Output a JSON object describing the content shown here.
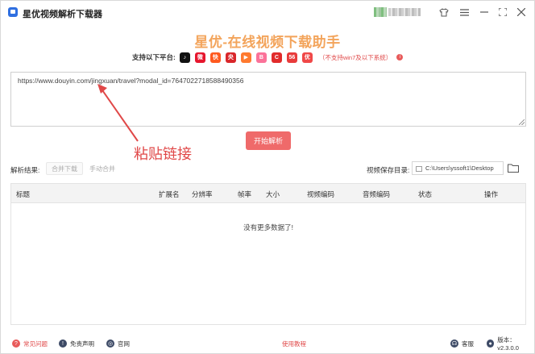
{
  "app": {
    "title": "星优视频解析下载器"
  },
  "headline": "星优-在线视频下载助手",
  "platforms": {
    "label": "支持以下平台:",
    "items": [
      {
        "name": "douyin-icon",
        "color": "#111111",
        "glyph": "♪"
      },
      {
        "name": "weibo-icon",
        "color": "#e6162d",
        "glyph": "微"
      },
      {
        "name": "kuaishou-icon",
        "color": "#ff5a1f",
        "glyph": "快"
      },
      {
        "name": "cctv-icon",
        "color": "#d9262a",
        "glyph": "央"
      },
      {
        "name": "tencent-video-icon",
        "color": "#ff7a2f",
        "glyph": "▶"
      },
      {
        "name": "bilibili-icon",
        "color": "#fb7299",
        "glyph": "B"
      },
      {
        "name": "acfun-icon",
        "color": "#e12b2b",
        "glyph": "C"
      },
      {
        "name": "56-icon",
        "color": "#e83b3b",
        "glyph": "56"
      },
      {
        "name": "youku-icon",
        "color": "#f04848",
        "glyph": "优"
      }
    ],
    "note": "（不支持win7及以下系统）"
  },
  "url_input": {
    "value": "https://www.douyin.com/jingxuan/travel?modal_id=7647022718588490356"
  },
  "paste_hint": "粘贴链接",
  "parse_button": "开始解析",
  "results": {
    "label": "解析结果:",
    "merge_download": "合并下载",
    "manual_merge": "手动合并",
    "save_dir_label": "视频保存目录:",
    "save_dir_value": "C:\\Users\\yssoft1\\Desktop"
  },
  "table": {
    "columns": [
      "标题",
      "扩展名",
      "分辨率",
      "帧率",
      "大小",
      "视频编码",
      "音频编码",
      "状态",
      "操作"
    ],
    "empty_message": "没有更多数据了!"
  },
  "footer": {
    "faq": "常见问题",
    "disclaimer": "免责声明",
    "website": "官网",
    "tutorial": "使用教程",
    "service": "客服",
    "version": "版本：v2.3.0.0"
  },
  "colors": {
    "accent": "#ef6a6a",
    "headline": "#f3a45b",
    "hint": "#e04848"
  }
}
